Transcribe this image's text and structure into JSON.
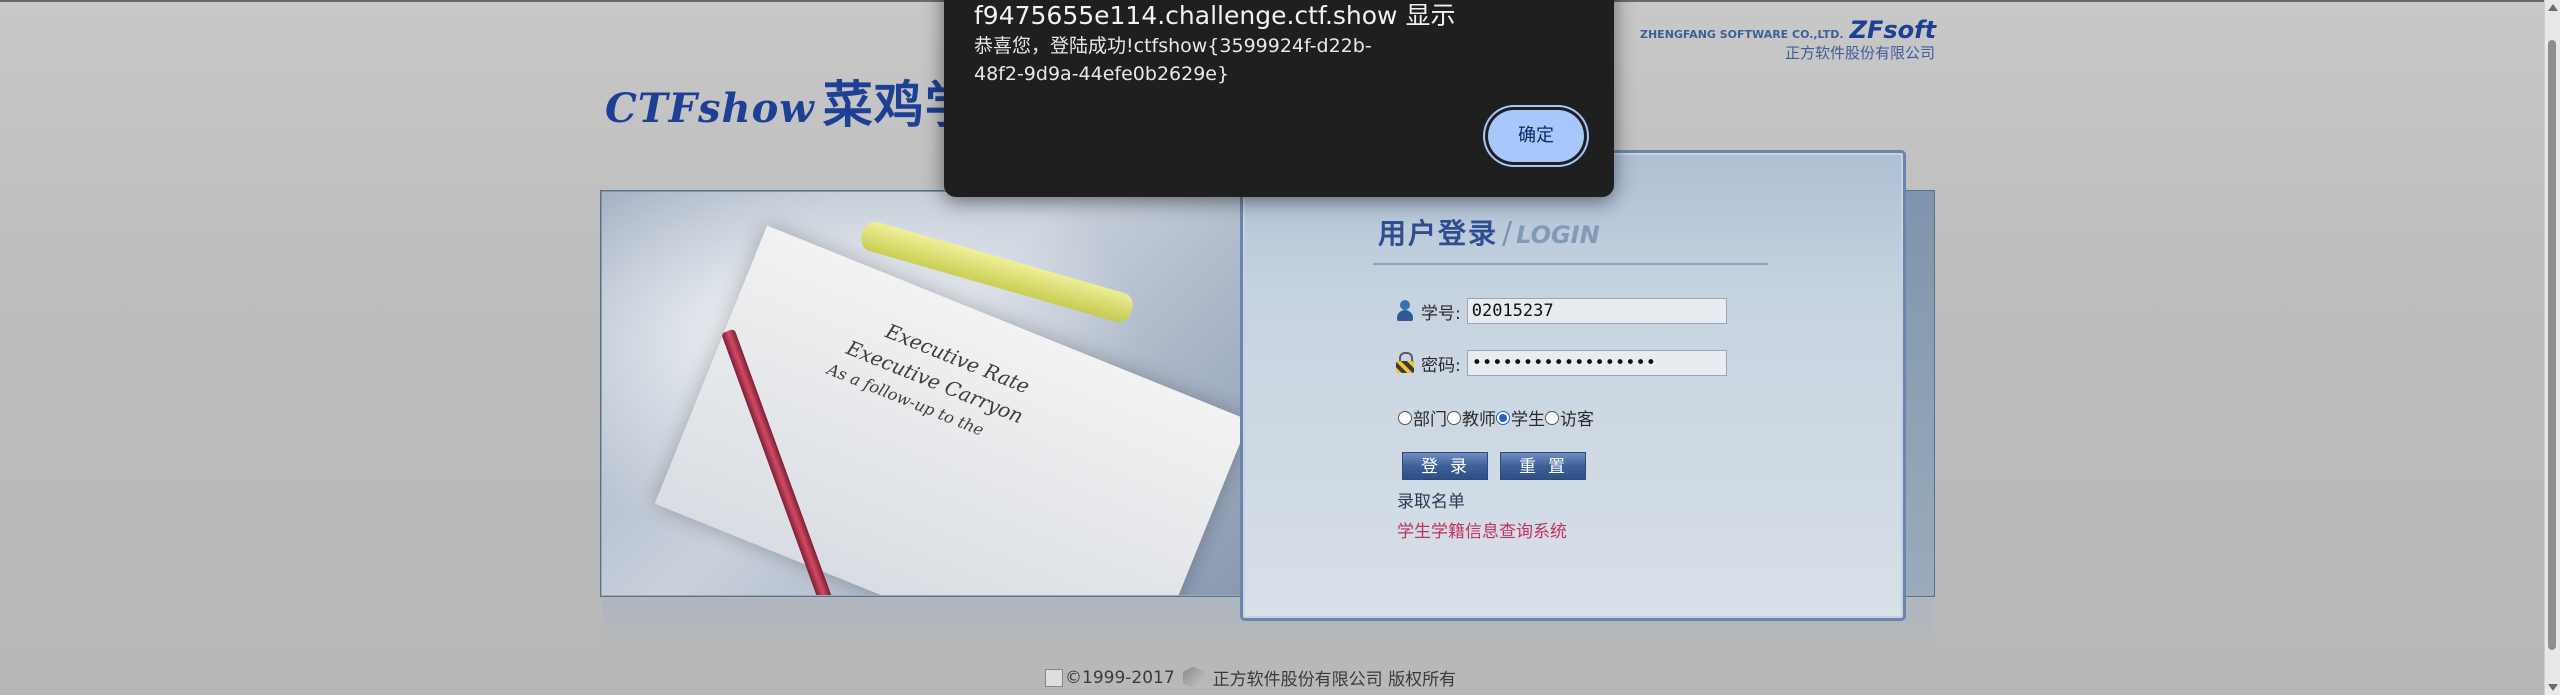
{
  "header": {
    "brand_en": "CTFshow",
    "brand_cn": "菜鸡学",
    "company_en": "ZHENGFANG SOFTWARE CO.,LTD.",
    "company_logo": "ZFsoft",
    "company_cn": "正方软件股份有限公司"
  },
  "photo": {
    "paper_line1": "Executive Rate",
    "paper_line2": "Executive Carryon",
    "paper_line3": "As a follow-up to the"
  },
  "login": {
    "title_cn": "用户登录",
    "title_sep": "/",
    "title_en": "LOGIN",
    "student_id_label": "学号:",
    "student_id_value": "02015237",
    "password_label": "密码:",
    "password_value": "••••••••••••••••••",
    "roles": [
      {
        "label": "部门",
        "checked": false
      },
      {
        "label": "教师",
        "checked": false
      },
      {
        "label": "学生",
        "checked": true
      },
      {
        "label": "访客",
        "checked": false
      }
    ],
    "login_button": "登录",
    "reset_button": "重置",
    "admission_link": "录取名单",
    "registry_link": "学生学籍信息查询系统"
  },
  "footer": {
    "copyright": "©1999-2017",
    "rights": "正方软件股份有限公司 版权所有"
  },
  "dialog": {
    "title": "f9475655e114.challenge.ctf.show 显示",
    "message": "恭喜您，登陆成功!ctfshow{3599924f-d22b-48f2-9d9a-44efe0b2629e}",
    "ok_label": "确定",
    "accent_color": "#a8c7fa"
  }
}
